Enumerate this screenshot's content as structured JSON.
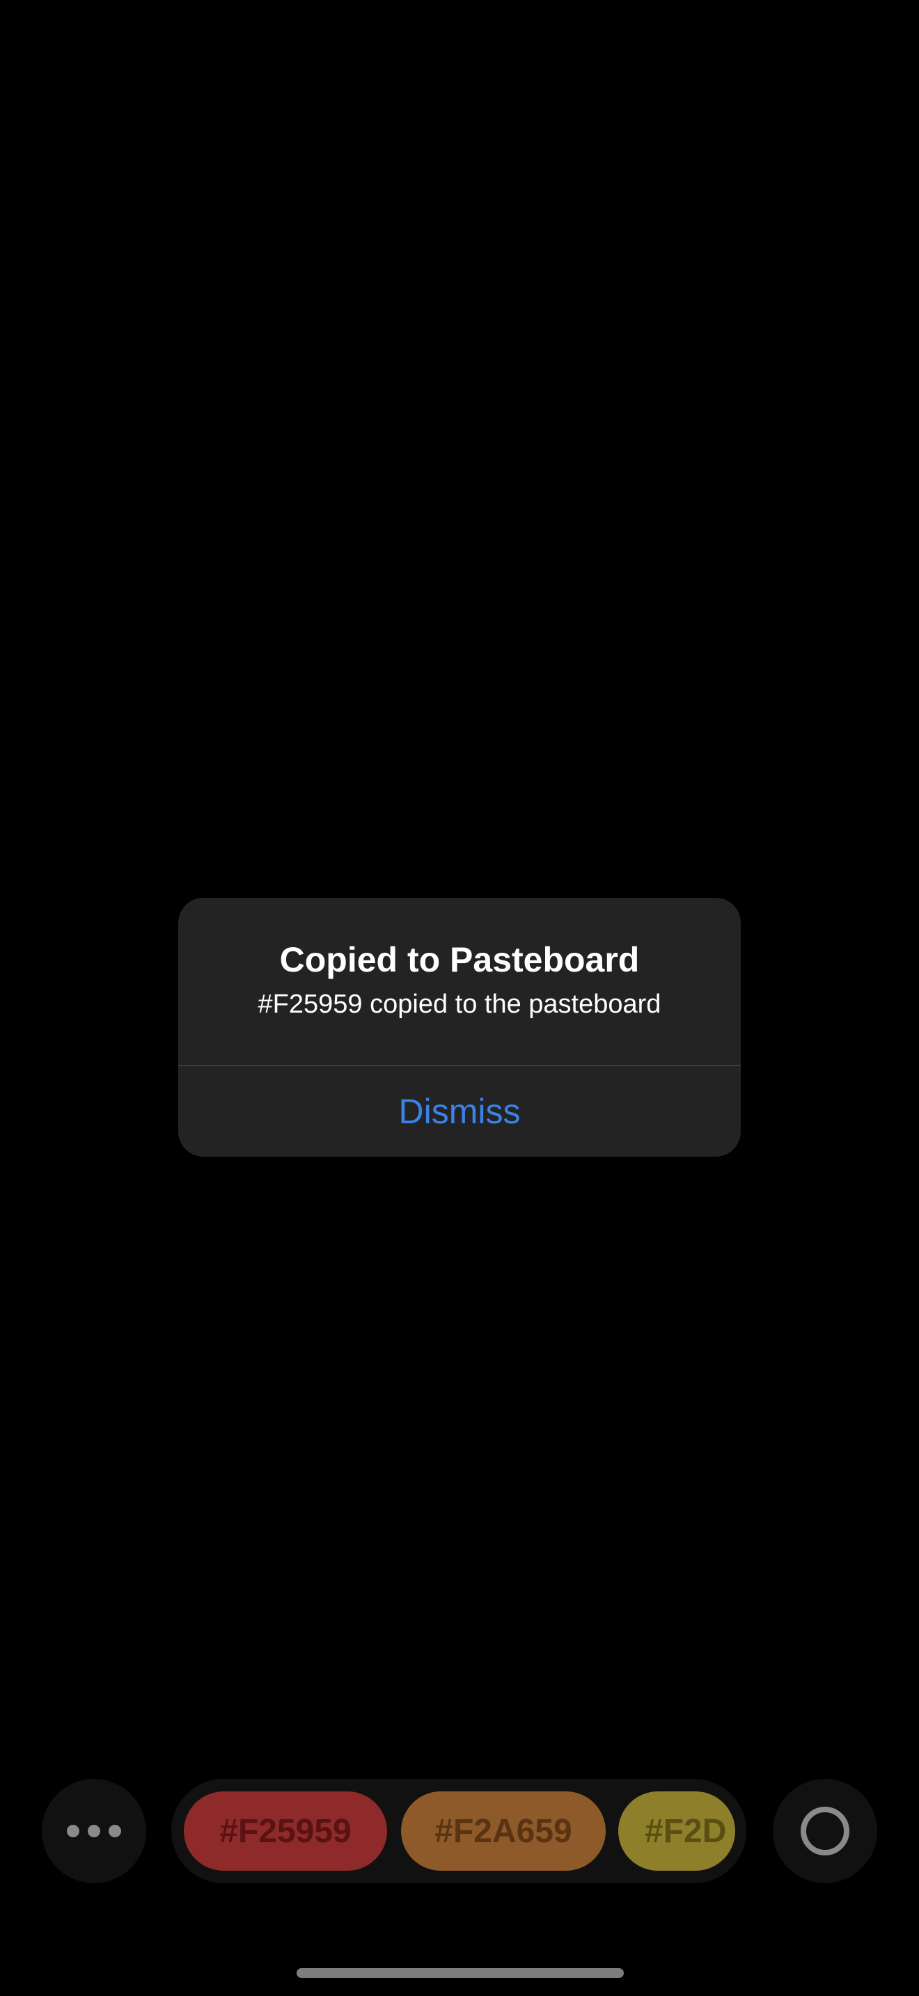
{
  "alert": {
    "title": "Copied to Pasteboard",
    "message": "#F25959 copied to the pasteboard",
    "dismiss_label": "Dismiss",
    "dismiss_color": "#3b82e6"
  },
  "toolbar": {
    "more_icon": "ellipsis-icon",
    "record_icon": "circle-ring-icon",
    "swatches": [
      {
        "label": "#F25959",
        "bg": "#8e2a2a",
        "fg": "#5a1212"
      },
      {
        "label": "#F2A659",
        "bg": "#8e5a2a",
        "fg": "#5a3312"
      },
      {
        "label": "#F2D",
        "bg": "#8e7f2a",
        "fg": "#5a4f12"
      }
    ]
  }
}
